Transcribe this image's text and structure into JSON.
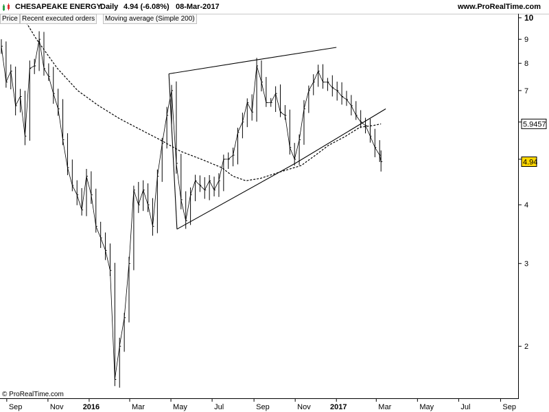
{
  "header": {
    "instrument": "CHESAPEAKE ENERGY",
    "period": "Daily",
    "quote": "4.94 (-6.08%)",
    "date": "08-Mar-2017",
    "site": "www.ProRealTime.com"
  },
  "tabs": [
    {
      "label": "Price",
      "color": "#000000"
    },
    {
      "label": "Recent executed orders",
      "color": "#ff6a6a"
    },
    {
      "label": "Moving average (Simple 200)",
      "color": "#000000"
    }
  ],
  "footer": {
    "copyright": "© ProRealTime.com"
  },
  "chart_data": {
    "type": "line",
    "subtype": "ohlc-bars",
    "x_axis_labels": [
      "Sep",
      "Nov",
      "2016",
      "Mar",
      "May",
      "Jul",
      "Sep",
      "Nov",
      "2017",
      "Mar",
      "May",
      "Jul",
      "Sep"
    ],
    "x_axis_dates": [
      "2015-09-01",
      "2015-11-01",
      "2016-01-01",
      "2016-03-01",
      "2016-05-01",
      "2016-07-01",
      "2016-09-01",
      "2016-11-01",
      "2017-01-01",
      "2017-03-01",
      "2017-05-01",
      "2017-07-01",
      "2017-09-01"
    ],
    "y_ticks": [
      2,
      3,
      4,
      5,
      6,
      7,
      8,
      9,
      10
    ],
    "y_scale": "log",
    "ylim": [
      1.55,
      10.2
    ],
    "xlim": [
      "2015-08-22",
      "2017-09-28"
    ],
    "current_price_label": "4.94",
    "ma_last_label": "5.9457",
    "price_color": "#000000",
    "price_tag_color": "#ffd700",
    "ma_tag_color": "#ffffff",
    "price_series": [
      [
        "2015-08-24",
        8.7
      ],
      [
        "2015-08-31",
        7.3
      ],
      [
        "2015-09-07",
        7.7
      ],
      [
        "2015-09-14",
        6.5
      ],
      [
        "2015-09-21",
        6.8
      ],
      [
        "2015-09-28",
        5.6
      ],
      [
        "2015-10-05",
        7.8
      ],
      [
        "2015-10-12",
        7.9
      ],
      [
        "2015-10-19",
        9.0
      ],
      [
        "2015-10-26",
        7.8
      ],
      [
        "2015-11-02",
        7.5
      ],
      [
        "2015-11-09",
        6.9
      ],
      [
        "2015-11-16",
        6.4
      ],
      [
        "2015-11-23",
        5.5
      ],
      [
        "2015-11-30",
        4.8
      ],
      [
        "2015-12-07",
        4.4
      ],
      [
        "2015-12-14",
        4.2
      ],
      [
        "2015-12-21",
        3.9
      ],
      [
        "2015-12-28",
        4.6
      ],
      [
        "2016-01-04",
        4.2
      ],
      [
        "2016-01-11",
        3.6
      ],
      [
        "2016-01-18",
        3.4
      ],
      [
        "2016-01-25",
        3.2
      ],
      [
        "2016-02-01",
        2.9
      ],
      [
        "2016-02-08",
        1.7
      ],
      [
        "2016-02-15",
        2.0
      ],
      [
        "2016-02-22",
        2.3
      ],
      [
        "2016-02-29",
        3.0
      ],
      [
        "2016-03-07",
        4.3
      ],
      [
        "2016-03-14",
        4.0
      ],
      [
        "2016-03-21",
        4.3
      ],
      [
        "2016-03-28",
        4.0
      ],
      [
        "2016-04-04",
        3.6
      ],
      [
        "2016-04-11",
        4.6
      ],
      [
        "2016-04-18",
        5.4
      ],
      [
        "2016-04-25",
        6.2
      ],
      [
        "2016-05-02",
        7.0
      ],
      [
        "2016-05-09",
        4.9
      ],
      [
        "2016-05-16",
        4.1
      ],
      [
        "2016-05-23",
        3.7
      ],
      [
        "2016-05-30",
        4.2
      ],
      [
        "2016-06-06",
        4.5
      ],
      [
        "2016-06-13",
        4.4
      ],
      [
        "2016-06-20",
        4.3
      ],
      [
        "2016-06-27",
        4.5
      ],
      [
        "2016-07-04",
        4.3
      ],
      [
        "2016-07-11",
        4.5
      ],
      [
        "2016-07-18",
        5.0
      ],
      [
        "2016-07-25",
        5.0
      ],
      [
        "2016-08-01",
        5.1
      ],
      [
        "2016-08-08",
        5.7
      ],
      [
        "2016-08-15",
        6.0
      ],
      [
        "2016-08-22",
        6.6
      ],
      [
        "2016-08-29",
        6.3
      ],
      [
        "2016-09-05",
        7.9
      ],
      [
        "2016-09-12",
        7.3
      ],
      [
        "2016-09-19",
        6.6
      ],
      [
        "2016-09-26",
        6.6
      ],
      [
        "2016-10-03",
        6.9
      ],
      [
        "2016-10-10",
        6.3
      ],
      [
        "2016-10-17",
        6.2
      ],
      [
        "2016-10-24",
        5.3
      ],
      [
        "2016-10-31",
        5.0
      ],
      [
        "2016-11-07",
        5.5
      ],
      [
        "2016-11-14",
        6.4
      ],
      [
        "2016-11-21",
        7.0
      ],
      [
        "2016-11-28",
        7.3
      ],
      [
        "2016-12-05",
        7.7
      ],
      [
        "2016-12-12",
        7.3
      ],
      [
        "2016-12-19",
        7.3
      ],
      [
        "2016-12-26",
        7.1
      ],
      [
        "2017-01-02",
        7.0
      ],
      [
        "2017-01-09",
        6.8
      ],
      [
        "2017-01-16",
        6.7
      ],
      [
        "2017-01-23",
        6.5
      ],
      [
        "2017-01-30",
        6.2
      ],
      [
        "2017-02-06",
        6.0
      ],
      [
        "2017-02-13",
        5.9
      ],
      [
        "2017-02-20",
        5.6
      ],
      [
        "2017-02-27",
        5.3
      ],
      [
        "2017-03-06",
        5.1
      ],
      [
        "2017-03-08",
        4.94
      ]
    ],
    "ma_series": [
      [
        "2015-09-22",
        10.2
      ],
      [
        "2015-10-15",
        9.0
      ],
      [
        "2015-11-15",
        7.8
      ],
      [
        "2015-12-15",
        7.0
      ],
      [
        "2016-01-15",
        6.5
      ],
      [
        "2016-02-15",
        6.1
      ],
      [
        "2016-03-15",
        5.8
      ],
      [
        "2016-04-15",
        5.5
      ],
      [
        "2016-05-15",
        5.2
      ],
      [
        "2016-06-15",
        5.0
      ],
      [
        "2016-07-15",
        4.8
      ],
      [
        "2016-08-01",
        4.6
      ],
      [
        "2016-08-20",
        4.5
      ],
      [
        "2016-09-10",
        4.55
      ],
      [
        "2016-10-10",
        4.7
      ],
      [
        "2016-11-10",
        4.85
      ],
      [
        "2016-12-01",
        5.1
      ],
      [
        "2016-12-20",
        5.35
      ],
      [
        "2017-01-15",
        5.6
      ],
      [
        "2017-02-05",
        5.85
      ],
      [
        "2017-02-25",
        5.9
      ],
      [
        "2017-03-08",
        5.9457
      ]
    ],
    "trendlines": [
      {
        "name": "upper-resistance",
        "points": [
          [
            "2016-04-28",
            7.6
          ],
          [
            "2016-09-08",
            8.15
          ],
          [
            "2017-01-01",
            8.65
          ]
        ]
      },
      {
        "name": "lower-support",
        "points": [
          [
            "2016-05-10",
            3.55
          ],
          [
            "2016-11-01",
            4.9
          ],
          [
            "2017-03-15",
            6.4
          ]
        ]
      },
      {
        "name": "apex-link",
        "points": [
          [
            "2016-04-28",
            7.6
          ],
          [
            "2016-05-10",
            3.55
          ]
        ]
      }
    ]
  }
}
